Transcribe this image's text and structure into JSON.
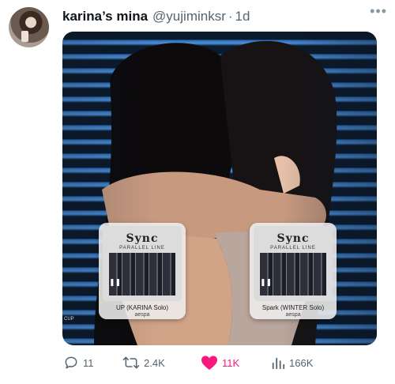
{
  "tweet": {
    "display_name": "karina’s mina",
    "handle": "@yujiminksr",
    "separator": "·",
    "timestamp": "1d",
    "more_icon": "ellipsis-icon"
  },
  "media": {
    "watermark": "CUP",
    "cards": [
      {
        "logo": "Sync",
        "subtitle": "PARALLEL LINE",
        "title": "UP (KARINA Solo)",
        "artist": "aespa",
        "play_icon": "pause-icon"
      },
      {
        "logo": "Sync",
        "subtitle": "PARALLEL LINE",
        "title": "Spark (WINTER Solo)",
        "artist": "aespa",
        "play_icon": "pause-icon"
      }
    ]
  },
  "actions": {
    "replies": "11",
    "reposts": "2.4K",
    "likes": "11K",
    "views": "166K",
    "like_color": "#f91880"
  }
}
